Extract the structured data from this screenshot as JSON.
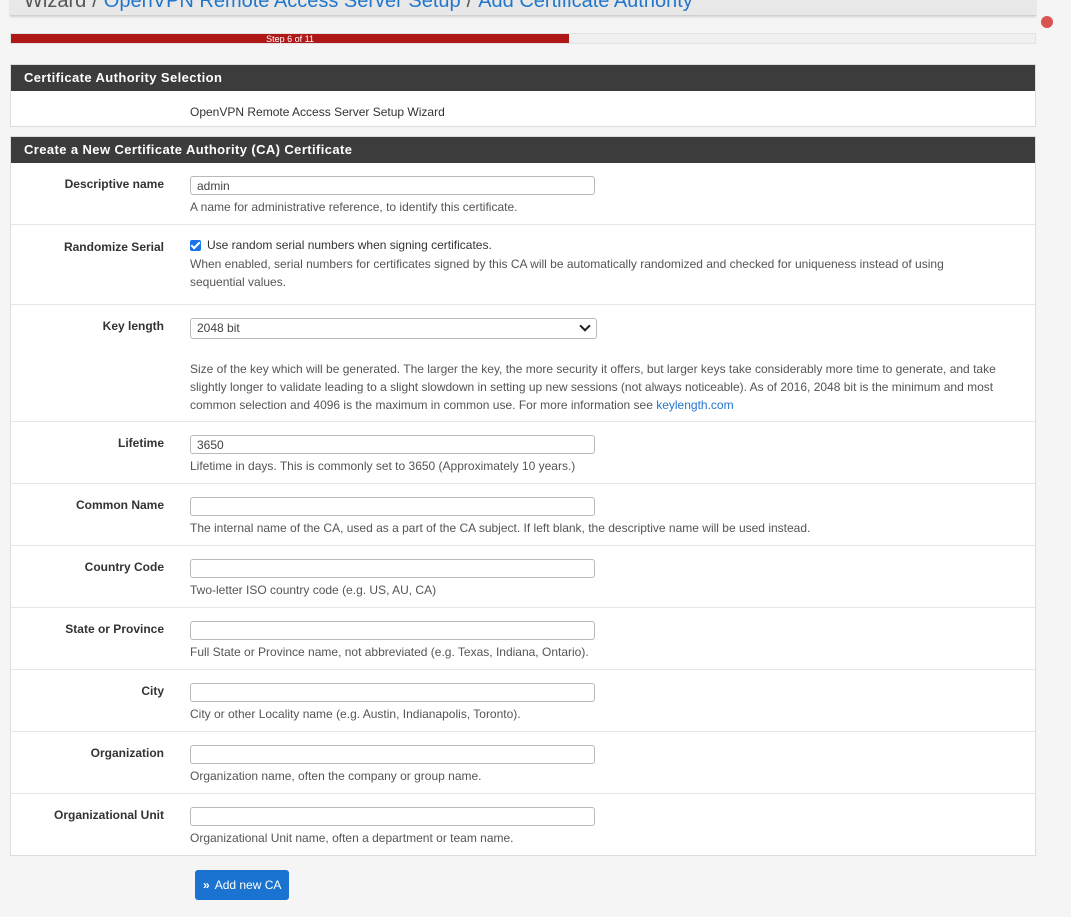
{
  "breadcrumb": {
    "root": "Wizard",
    "items": [
      "OpenVPN Remote Access Server Setup",
      "Add Certificate Authority"
    ]
  },
  "progress": {
    "label": "Step 6 of 11",
    "fraction": 0.545
  },
  "ca_selection": {
    "heading": "Certificate Authority Selection",
    "wizard_name": "OpenVPN Remote Access Server Setup Wizard"
  },
  "create_ca": {
    "heading": "Create a New Certificate Authority (CA) Certificate",
    "descriptive_name": {
      "label": "Descriptive name",
      "value": "admin",
      "help": "A name for administrative reference, to identify this certificate."
    },
    "randomize_serial": {
      "label": "Randomize Serial",
      "checkbox_label": "Use random serial numbers when signing certificates.",
      "checked": true,
      "help": "When enabled, serial numbers for certificates signed by this CA will be automatically randomized and checked for uniqueness instead of using sequential values."
    },
    "key_length": {
      "label": "Key length",
      "value": "2048 bit",
      "help": "Size of the key which will be generated. The larger the key, the more security it offers, but larger keys take considerably more time to generate, and take slightly longer to validate leading to a slight slowdown in setting up new sessions (not always noticeable). As of 2016, 2048 bit is the minimum and most common selection and 4096 is the maximum in common use. For more information see",
      "link": "keylength.com"
    },
    "lifetime": {
      "label": "Lifetime",
      "value": "3650",
      "help": "Lifetime in days. This is commonly set to 3650 (Approximately 10 years.)"
    },
    "common_name": {
      "label": "Common Name",
      "value": "",
      "help": "The internal name of the CA, used as a part of the CA subject. If left blank, the descriptive name will be used instead."
    },
    "country_code": {
      "label": "Country Code",
      "value": "",
      "help": "Two-letter ISO country code (e.g. US, AU, CA)"
    },
    "state": {
      "label": "State or Province",
      "value": "",
      "help": "Full State or Province name, not abbreviated (e.g. Texas, Indiana, Ontario)."
    },
    "city": {
      "label": "City",
      "value": "",
      "help": "City or other Locality name (e.g. Austin, Indianapolis, Toronto)."
    },
    "organization": {
      "label": "Organization",
      "value": "",
      "help": "Organization name, often the company or group name."
    },
    "org_unit": {
      "label": "Organizational Unit",
      "value": "",
      "help": "Organizational Unit name, often a department or team name."
    }
  },
  "submit": {
    "label": "Add new CA",
    "icon": "double-chevron-right-icon"
  },
  "colors": {
    "accent": "#1a73d0",
    "progress": "#b01818",
    "heading_bg": "#3c3c3c"
  }
}
